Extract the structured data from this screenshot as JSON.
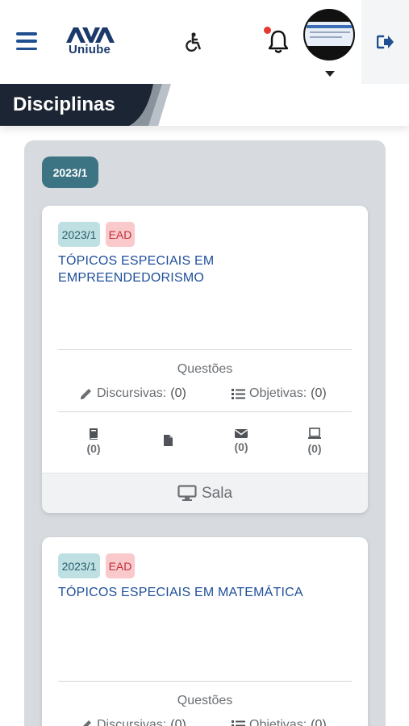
{
  "header": {
    "logo_text": "Uniube",
    "logo_mark": "AVA"
  },
  "page": {
    "title": "Disciplinas"
  },
  "colors": {
    "primary_blue": "#1f4f8f",
    "teal_pill": "#3d7484",
    "ead_badge": "#f9c9cc",
    "year_badge": "#bfe0e3",
    "notification_dot": "#e53935"
  },
  "period": {
    "label": "2023/1"
  },
  "courses": [
    {
      "year_badge": "2023/1",
      "mode_badge": "EAD",
      "title": "TÓPICOS ESPECIAIS EM EMPREENDEDORISMO",
      "questoes_label": "Questões",
      "discursivas_label": "Discursivas:",
      "discursivas_count": "(0)",
      "objetivas_label": "Objetivas:",
      "objetivas_count": "(0)",
      "stats": {
        "book": "(0)",
        "mail": "(0)",
        "laptop": "(0)"
      },
      "room_label": "Sala"
    },
    {
      "year_badge": "2023/1",
      "mode_badge": "EAD",
      "title": "TÓPICOS ESPECIAIS EM MATEMÁTICA",
      "questoes_label": "Questões",
      "discursivas_label": "Discursivas:",
      "discursivas_count": "(0)",
      "objetivas_label": "Objetivas:",
      "objetivas_count": "(0)"
    }
  ]
}
